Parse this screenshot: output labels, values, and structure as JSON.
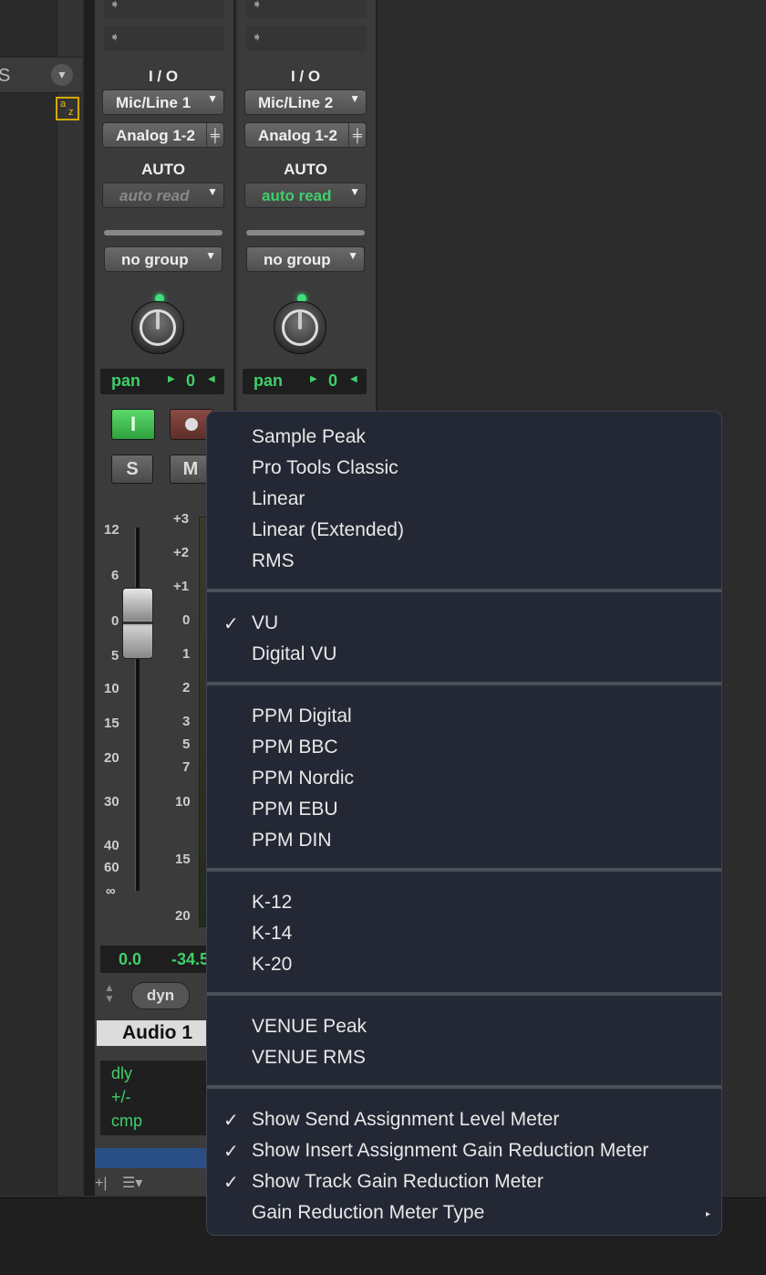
{
  "left_panel": {
    "header_letter": "S",
    "sort_icon_a": "a",
    "sort_icon_z": "z"
  },
  "strips": [
    {
      "io_label": "I / O",
      "input": "Mic/Line 1",
      "output": "Analog 1-2",
      "auto_label": "AUTO",
      "automation_mode": "auto read",
      "automation_active": false,
      "group": "no group",
      "pan_label": "pan",
      "pan_value": "0"
    },
    {
      "io_label": "I / O",
      "input": "Mic/Line 2",
      "output": "Analog 1-2",
      "auto_label": "AUTO",
      "automation_mode": "auto read",
      "automation_active": true,
      "group": "no group",
      "pan_label": "pan",
      "pan_value": "0"
    }
  ],
  "strip1_controls": {
    "input_button": "I",
    "solo": "S",
    "mute": "M",
    "fader_scale": [
      "12",
      "6",
      "0",
      "5",
      "10",
      "15",
      "20",
      "30",
      "40",
      "60",
      "∞"
    ],
    "meter_scale": [
      "+3",
      "+2",
      "+1",
      "0",
      "1",
      "2",
      "3",
      "5",
      "7",
      "10",
      "15",
      "20"
    ],
    "volume": "0.0",
    "peak": "-34.5",
    "dyn": "dyn",
    "track_name": "Audio 1",
    "delay_rows": [
      "dly",
      "+/-",
      "cmp"
    ]
  },
  "menu": {
    "groups": [
      {
        "items": [
          {
            "label": "Sample Peak",
            "checked": false
          },
          {
            "label": "Pro Tools Classic",
            "checked": false
          },
          {
            "label": "Linear",
            "checked": false
          },
          {
            "label": "Linear (Extended)",
            "checked": false
          },
          {
            "label": "RMS",
            "checked": false
          }
        ]
      },
      {
        "items": [
          {
            "label": "VU",
            "checked": true
          },
          {
            "label": "Digital VU",
            "checked": false
          }
        ]
      },
      {
        "items": [
          {
            "label": "PPM Digital",
            "checked": false
          },
          {
            "label": "PPM BBC",
            "checked": false
          },
          {
            "label": "PPM Nordic",
            "checked": false
          },
          {
            "label": "PPM EBU",
            "checked": false
          },
          {
            "label": "PPM DIN",
            "checked": false
          }
        ]
      },
      {
        "items": [
          {
            "label": "K-12",
            "checked": false
          },
          {
            "label": "K-14",
            "checked": false
          },
          {
            "label": "K-20",
            "checked": false
          }
        ]
      },
      {
        "items": [
          {
            "label": "VENUE Peak",
            "checked": false
          },
          {
            "label": "VENUE RMS",
            "checked": false
          }
        ]
      },
      {
        "items": [
          {
            "label": "Show Send Assignment Level Meter",
            "checked": true
          },
          {
            "label": "Show Insert Assignment Gain Reduction Meter",
            "checked": true
          },
          {
            "label": "Show Track Gain Reduction Meter",
            "checked": true
          },
          {
            "label": "Gain Reduction Meter Type",
            "checked": false,
            "submenu": true
          }
        ]
      }
    ],
    "check_glyph": "✓",
    "submenu_glyph": "▸"
  },
  "colors": {
    "green_text": "#3fcf6a",
    "menu_bg": "#232834",
    "input_green": "#4ccd5c"
  }
}
